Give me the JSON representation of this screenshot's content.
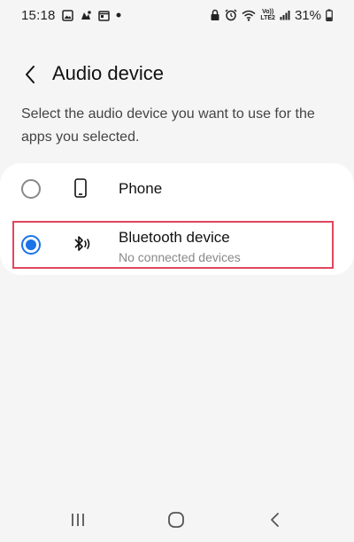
{
  "status_bar": {
    "time": "15:18",
    "lte_top": "Vo))",
    "lte_bottom": "LTE2",
    "battery": "31%"
  },
  "header": {
    "back_icon": "chevron-left-icon",
    "title": "Audio device"
  },
  "description": "Select the audio device you want to use for the apps you selected.",
  "options": [
    {
      "label": "Phone",
      "icon": "phone-icon",
      "selected": false
    },
    {
      "label": "Bluetooth device",
      "sublabel": "No connected devices",
      "icon": "bluetooth-audio-icon",
      "selected": true
    }
  ],
  "nav": {
    "recents_icon": "recents-icon",
    "home_icon": "home-icon",
    "back_icon": "back-icon"
  },
  "colors": {
    "accent": "#1a73e8",
    "highlight": "#e0465e",
    "background": "#f5f5f5",
    "card": "#ffffff"
  }
}
